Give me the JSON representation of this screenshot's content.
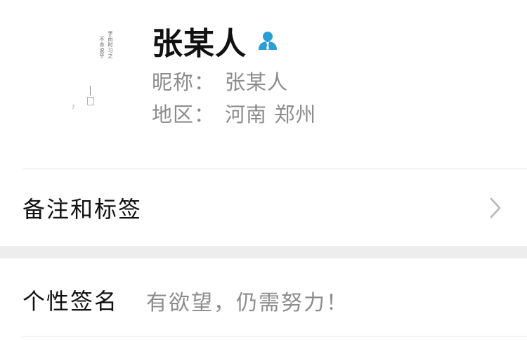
{
  "profile": {
    "name": "张某人",
    "contact_icon": "person-badge-icon",
    "nickname_label": "昵称：",
    "nickname": "张某人",
    "region_label": "地区：",
    "region": "河南 郑州",
    "avatar": {
      "poem_col1": "学而时习之",
      "poem_col2": "不亦说乎",
      "poem_col3": "论语",
      "poem_col4": "",
      "icon": "calligraphy-avatar"
    }
  },
  "remark_row": {
    "label": "备注和标签",
    "chevron_icon": "chevron-right-icon"
  },
  "signature_row": {
    "label": "个性签名",
    "value": "有欲望，仍需努力！"
  },
  "colors": {
    "accent_icon": "#2a9fd6",
    "muted_text": "#8c8c8c",
    "gap": "#ededed",
    "divider": "#e6e6e6"
  }
}
